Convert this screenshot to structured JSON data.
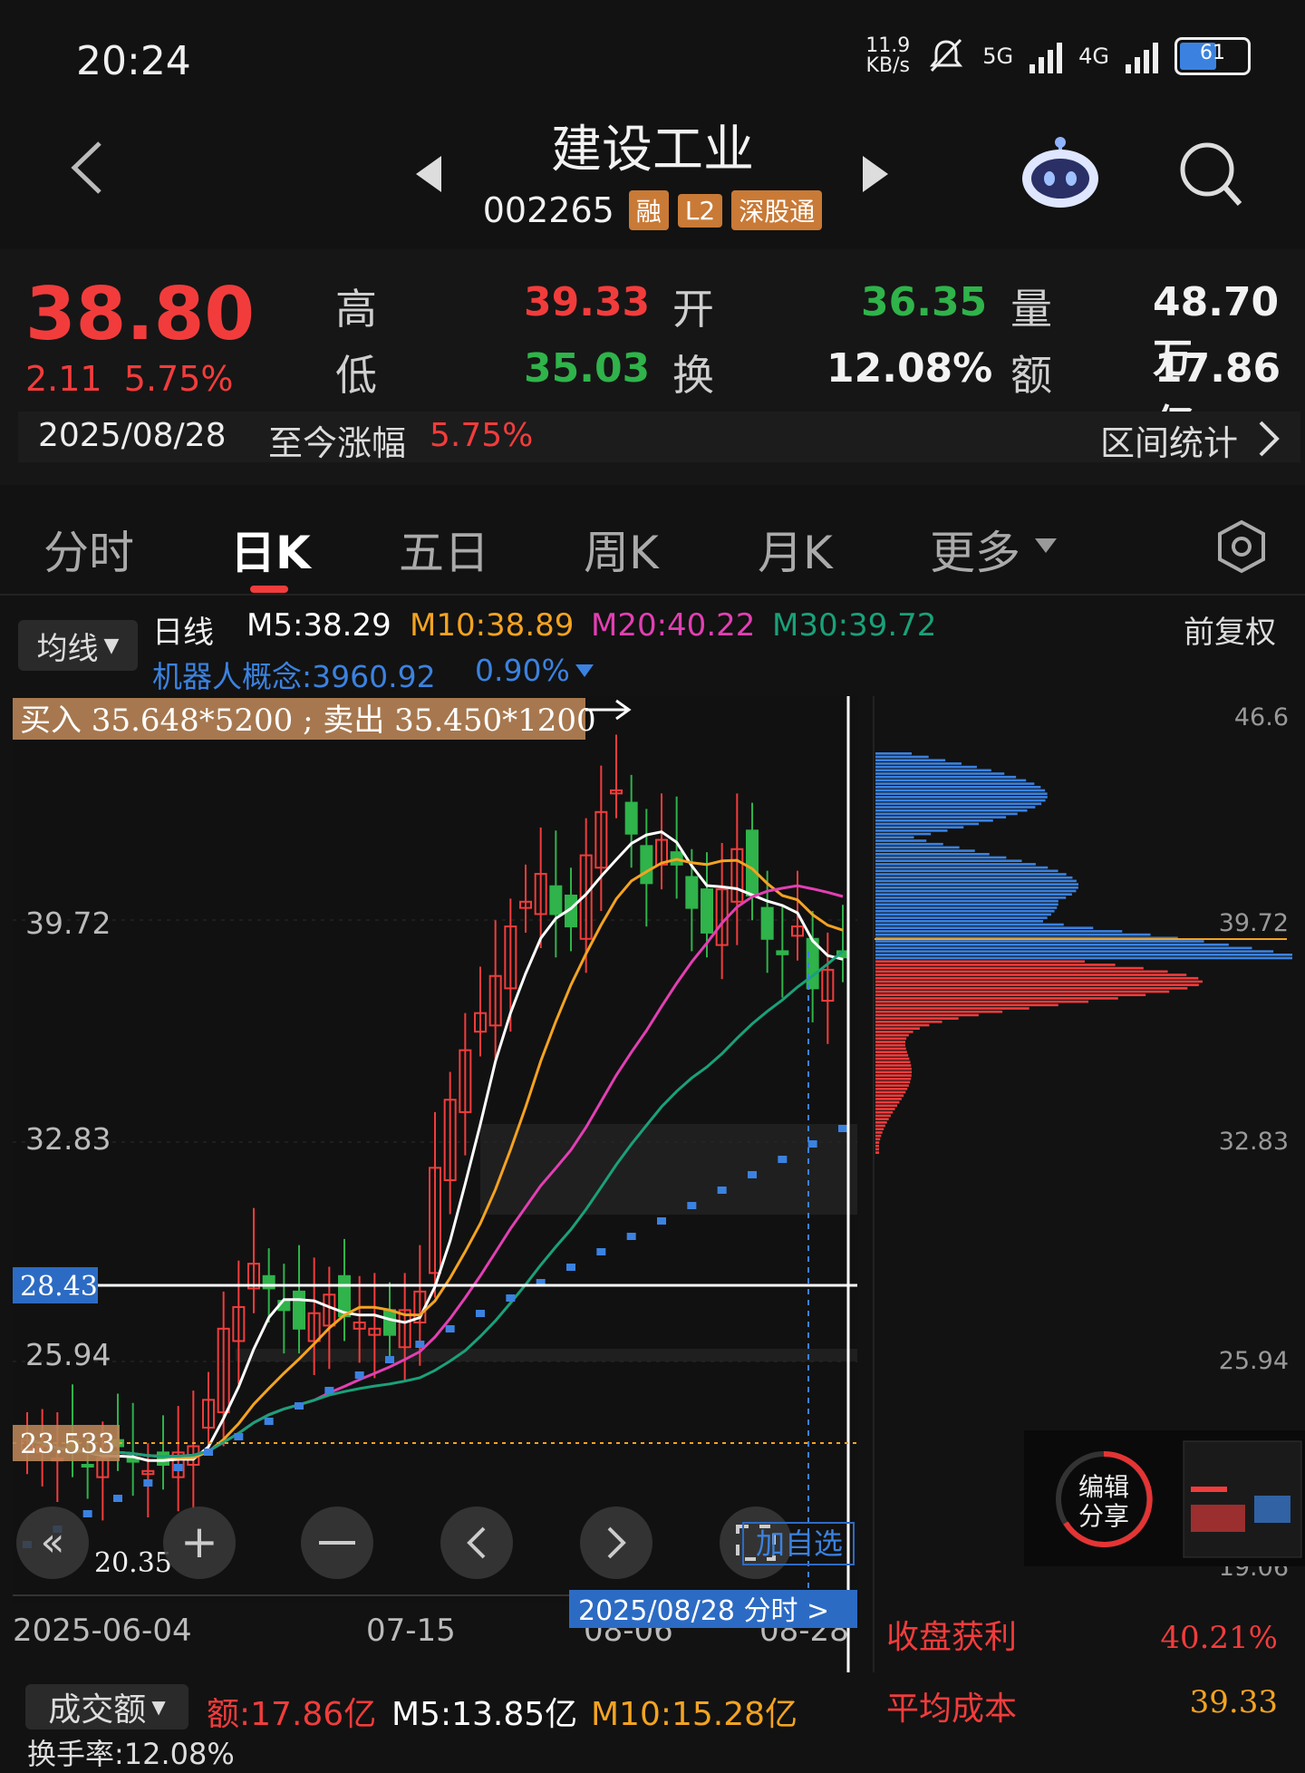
{
  "status": {
    "time": "20:24",
    "net_speed": "11.9",
    "net_unit": "KB/s",
    "sig1": "5G",
    "sig2": "4G",
    "battery": "61"
  },
  "header": {
    "title": "建设工业",
    "code": "002265",
    "badges": [
      "融",
      "L2",
      "深股通"
    ]
  },
  "quote": {
    "price": "38.80",
    "change": "2.11",
    "change_pct": "5.75%",
    "high_label": "高",
    "high": "39.33",
    "open_label": "开",
    "open": "36.35",
    "vol_label": "量",
    "vol": "48.70万",
    "low_label": "低",
    "low": "35.03",
    "turn_label": "换",
    "turn": "12.08%",
    "amt_label": "额",
    "amt": "17.86亿",
    "date": "2025/08/28",
    "since_label": "至今涨幅",
    "since_pct": "5.75%",
    "range_stats": "区间统计"
  },
  "tabs": [
    "分时",
    "日K",
    "五日",
    "周K",
    "月K",
    "更多"
  ],
  "legend": {
    "select": "均线",
    "period": "日线",
    "m5": "M5:38.29",
    "m10": "M10:38.89",
    "m20": "M20:40.22",
    "m30": "M30:39.72",
    "adjust": "前复权",
    "concept": "机器人概念:3960.92",
    "concept_pct": "0.90%"
  },
  "chart": {
    "trade_note": "买入 35.648*5200 ; 卖出 35.450*1200",
    "y_ticks": [
      "39.72",
      "32.83",
      "25.94"
    ],
    "right_ticks": [
      "46.6",
      "39.72",
      "32.83",
      "25.94",
      "19.06"
    ],
    "hline_label": "28.43",
    "cost_label": "23.533",
    "low_label": "20.35",
    "x_labels": [
      "2025-06-04",
      "07-15",
      "08-06",
      "08-28"
    ],
    "cursor_label": "2025/08/28  分时  >",
    "add_watch": "加自选",
    "share_title": "编辑",
    "share_sub": "分享"
  },
  "chip": {
    "profit_label": "收盘获利",
    "profit": "40.21%",
    "avg_label": "平均成本",
    "avg": "39.33"
  },
  "volume": {
    "select": "成交额",
    "amt": "额:17.86亿",
    "m5": "M5:13.85亿",
    "m10": "M10:15.28亿",
    "turnover": "换手率:12.08%"
  },
  "chart_data": {
    "type": "candlestick",
    "ylim": [
      19.06,
      46.6
    ],
    "series": [
      {
        "name": "M5"
      },
      {
        "name": "M10"
      },
      {
        "name": "M20"
      },
      {
        "name": "M30"
      }
    ],
    "close": [
      23.2,
      23.0,
      22.6,
      22.8,
      22.4,
      22.6,
      23.0,
      22.5,
      22.2,
      22.4,
      22.8,
      23.0,
      24.5,
      26.8,
      27.5,
      28.9,
      28.1,
      27.4,
      26.8,
      27.3,
      27.9,
      27.2,
      27.0,
      26.8,
      26.6,
      27.4,
      28.0,
      32.0,
      34.2,
      35.8,
      37.0,
      38.2,
      39.8,
      40.6,
      41.5,
      40.2,
      39.8,
      42.1,
      43.5,
      44.2,
      42.8,
      41.2,
      42.6,
      41.8,
      40.4,
      39.6,
      41.0,
      42.3,
      40.8,
      39.4,
      38.9,
      39.8,
      37.8,
      38.4,
      38.8
    ],
    "colors": {
      "up": "#f23c3c",
      "down": "#2fb34a",
      "m5": "#ffffff",
      "m10": "#f4a321",
      "m20": "#e33fb3",
      "m30": "#1aa179",
      "accent": "#3b82e0"
    }
  }
}
